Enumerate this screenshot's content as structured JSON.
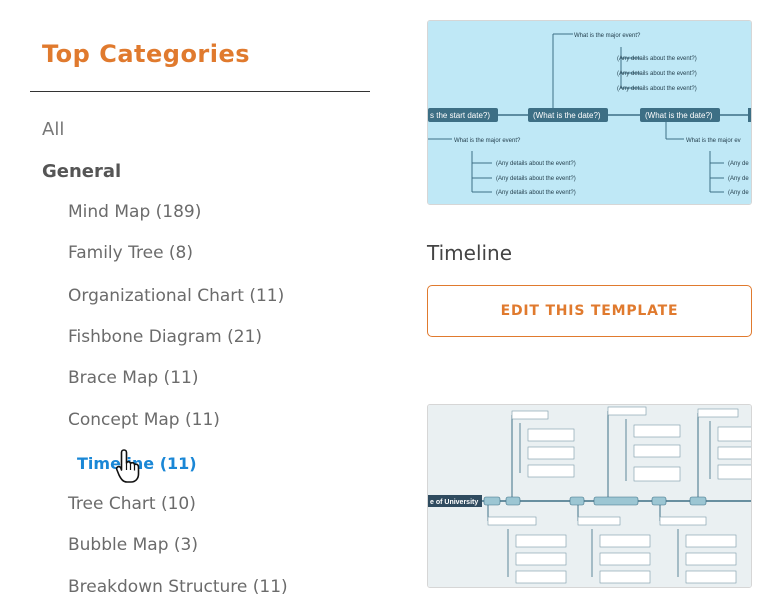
{
  "sidebar": {
    "title": "Top Categories",
    "all_label": "All",
    "group_label": "General",
    "items": [
      {
        "label": "Mind Map (189)"
      },
      {
        "label": "Family Tree (8)"
      },
      {
        "label": "Organizational Chart (11)"
      },
      {
        "label": "Fishbone Diagram (21)"
      },
      {
        "label": "Brace Map (11)"
      },
      {
        "label": "Concept Map (11)"
      },
      {
        "label": "Timeline (11)",
        "active": true
      },
      {
        "label": "Tree Chart (10)"
      },
      {
        "label": "Bubble Map (3)"
      },
      {
        "label": "Breakdown Structure (11)"
      }
    ]
  },
  "templates": [
    {
      "name": "Timeline",
      "button_label": "EDIT THIS TEMPLATE",
      "thumbnail": {
        "top_event": "What is the major event?",
        "top_details": [
          "(Any details about the event?)",
          "(Any details about the event?)",
          "(Any details about the event?)"
        ],
        "dates": [
          "s the start date?)",
          "(What is the date?)",
          "(What is the date?)"
        ],
        "bottom_event_left": "What is the major event?",
        "bottom_event_right": "What is the major ev",
        "bottom_details": [
          "(Any details about the event?)",
          "(Any details about the event?)",
          "(Any details about the event?)"
        ],
        "right_details": [
          "(Any de",
          "(Any de",
          "(Any de"
        ]
      }
    },
    {
      "thumbnail": {
        "root": "e of University"
      }
    }
  ],
  "colors": {
    "accent": "#e07a2e",
    "active": "#1a87d6",
    "timeline_bg": "#bfe8f6",
    "node_dark": "#3d6f85"
  }
}
